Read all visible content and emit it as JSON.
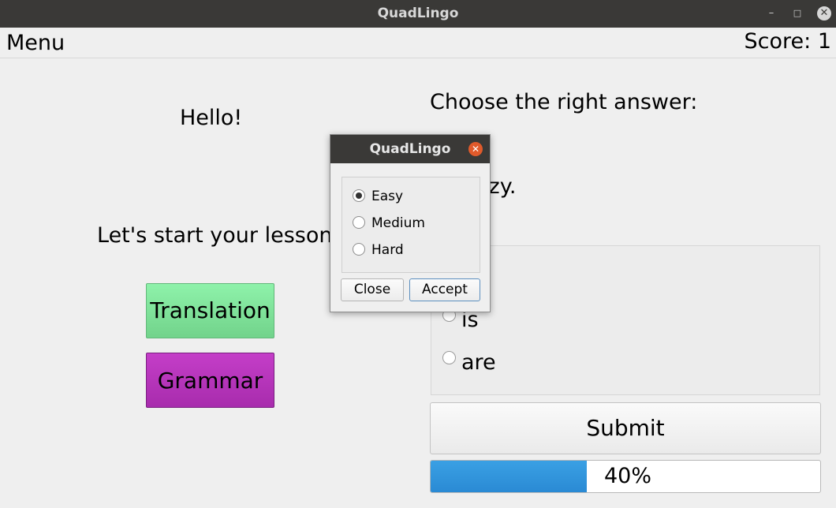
{
  "window": {
    "title": "QuadLingo"
  },
  "menubar": {
    "menu_label": "Menu",
    "score_text": "Score: 1"
  },
  "left": {
    "greeting": "Hello!",
    "prompt": "Let's start your lesson",
    "translation_button": "Translation",
    "grammar_button": "Grammar"
  },
  "right": {
    "question": "Choose the right answer:",
    "sentence_visible": "azy.",
    "options": [
      {
        "label": "is"
      },
      {
        "label": "are"
      }
    ],
    "submit_label": "Submit",
    "progress_value": 40,
    "progress_text": "40%"
  },
  "dialog": {
    "title": "QuadLingo",
    "options": [
      {
        "label": "Easy",
        "selected": true
      },
      {
        "label": "Medium",
        "selected": false
      },
      {
        "label": "Hard",
        "selected": false
      }
    ],
    "close_label": "Close",
    "accept_label": "Accept"
  },
  "colors": {
    "translation_bg": "#7fe29a",
    "grammar_bg": "#b533ba",
    "progress_fill": "#2f93dc",
    "titlebar_bg": "#3a3937",
    "dialog_close": "#e05a2b"
  },
  "icons": {
    "minimize": "minimize-icon",
    "maximize": "maximize-icon",
    "close": "close-icon",
    "dialog_close": "close-icon"
  }
}
